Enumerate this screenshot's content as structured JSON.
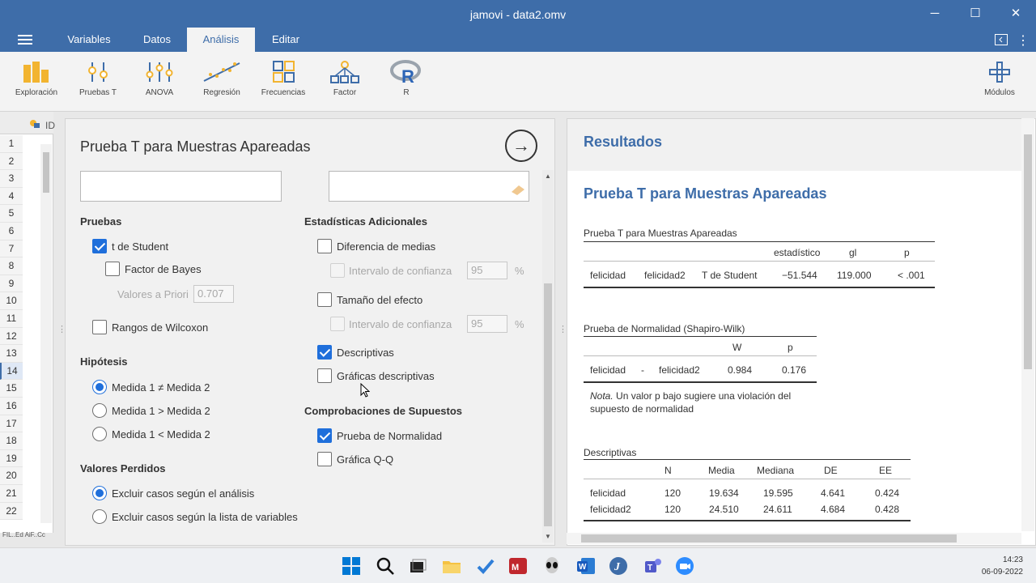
{
  "window": {
    "title": "jamovi - data2.omv",
    "minimize": "─",
    "maximize": "☐",
    "close": "✕"
  },
  "tabs": [
    {
      "label": "Variables"
    },
    {
      "label": "Datos"
    },
    {
      "label": "Análisis"
    },
    {
      "label": "Editar"
    }
  ],
  "active_tab": "Análisis",
  "ribbon": [
    {
      "label": "Exploración",
      "icon": "bar-chart-icon"
    },
    {
      "label": "Pruebas T",
      "icon": "t-test-icon"
    },
    {
      "label": "ANOVA",
      "icon": "anova-icon"
    },
    {
      "label": "Regresión",
      "icon": "regression-icon"
    },
    {
      "label": "Frecuencias",
      "icon": "frequencies-icon"
    },
    {
      "label": "Factor",
      "icon": "factor-icon"
    },
    {
      "label": "R",
      "icon": "r-logo-icon"
    },
    {
      "label": "Módulos",
      "icon": "plus-icon"
    }
  ],
  "sheet": {
    "column_header": "ID",
    "rows": [
      "1",
      "2",
      "3",
      "4",
      "5",
      "6",
      "7",
      "8",
      "9",
      "10",
      "11",
      "12",
      "13",
      "14",
      "15",
      "16",
      "17",
      "18",
      "19",
      "20",
      "21",
      "22"
    ],
    "selected_row": "14",
    "status": "FIL..Ed  AiF..Cc"
  },
  "analysis": {
    "title": "Prueba T para Muestras Apareadas",
    "sections": {
      "pruebas": "Pruebas",
      "estadisticas": "Estadísticas Adicionales",
      "hipotesis": "Hipótesis",
      "comprobaciones": "Comprobaciones de Supuestos",
      "perdidos": "Valores Perdidos"
    },
    "t_student": "t de Student",
    "factor_bayes": "Factor de Bayes",
    "valores_priori": "Valores a Priori",
    "priori_value": "0.707",
    "wilcoxon": "Rangos de Wilcoxon",
    "diferencia_medias": "Diferencia de medias",
    "intervalo_confianza": "Intervalo de confianza",
    "ci_value_1": "95",
    "ci_value_2": "95",
    "percent": "%",
    "tamano_efecto": "Tamaño del efecto",
    "descriptivas": "Descriptivas",
    "graficas_descriptivas": "Gráficas descriptivas",
    "prueba_normalidad": "Prueba de Normalidad",
    "grafica_qq": "Gráfica Q-Q",
    "h_ne": "Medida 1 ≠ Medida 2",
    "h_gt": "Medida 1 > Medida 2",
    "h_lt": "Medida 1 < Medida 2",
    "excluir_analisis": "Excluir casos según el análisis",
    "excluir_lista": "Excluir casos según la lista de variables"
  },
  "results": {
    "header": "Resultados",
    "title": "Prueba T para Muestras Apareadas",
    "ttest": {
      "caption": "Prueba T para Muestras Apareadas",
      "headers": [
        "estadístico",
        "gl",
        "p"
      ],
      "row": [
        "felicidad",
        "felicidad2",
        "T de Student",
        "−51.544",
        "119.000",
        "< .001"
      ]
    },
    "normality": {
      "caption": "Prueba de Normalidad (Shapiro-Wilk)",
      "headers": [
        "W",
        "p"
      ],
      "row": [
        "felicidad",
        "-",
        "felicidad2",
        "0.984",
        "0.176"
      ],
      "note_label": "Nota.",
      "note_line1": " Un valor p bajo sugiere una violación del",
      "note_line2": "supuesto de normalidad"
    },
    "descriptives": {
      "caption": "Descriptivas",
      "headers": [
        "N",
        "Media",
        "Mediana",
        "DE",
        "EE"
      ],
      "rows": [
        [
          "felicidad",
          "120",
          "19.634",
          "19.595",
          "4.641",
          "0.424"
        ],
        [
          "felicidad2",
          "120",
          "24.510",
          "24.611",
          "4.684",
          "0.428"
        ]
      ]
    }
  },
  "taskbar": {
    "time": "14:23",
    "date": "06-09-2022"
  },
  "colors": {
    "brand": "#3e6da9",
    "check": "#1f6fdb"
  }
}
